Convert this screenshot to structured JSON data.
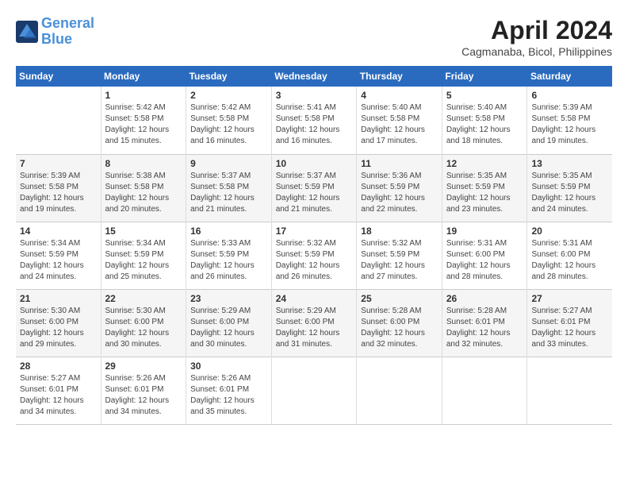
{
  "header": {
    "logo_line1": "General",
    "logo_line2": "Blue",
    "month": "April 2024",
    "location": "Cagmanaba, Bicol, Philippines"
  },
  "days_of_week": [
    "Sunday",
    "Monday",
    "Tuesday",
    "Wednesday",
    "Thursday",
    "Friday",
    "Saturday"
  ],
  "weeks": [
    [
      {
        "day": "",
        "info": ""
      },
      {
        "day": "1",
        "info": "Sunrise: 5:42 AM\nSunset: 5:58 PM\nDaylight: 12 hours\nand 15 minutes."
      },
      {
        "day": "2",
        "info": "Sunrise: 5:42 AM\nSunset: 5:58 PM\nDaylight: 12 hours\nand 16 minutes."
      },
      {
        "day": "3",
        "info": "Sunrise: 5:41 AM\nSunset: 5:58 PM\nDaylight: 12 hours\nand 16 minutes."
      },
      {
        "day": "4",
        "info": "Sunrise: 5:40 AM\nSunset: 5:58 PM\nDaylight: 12 hours\nand 17 minutes."
      },
      {
        "day": "5",
        "info": "Sunrise: 5:40 AM\nSunset: 5:58 PM\nDaylight: 12 hours\nand 18 minutes."
      },
      {
        "day": "6",
        "info": "Sunrise: 5:39 AM\nSunset: 5:58 PM\nDaylight: 12 hours\nand 19 minutes."
      }
    ],
    [
      {
        "day": "7",
        "info": "Sunrise: 5:39 AM\nSunset: 5:58 PM\nDaylight: 12 hours\nand 19 minutes."
      },
      {
        "day": "8",
        "info": "Sunrise: 5:38 AM\nSunset: 5:58 PM\nDaylight: 12 hours\nand 20 minutes."
      },
      {
        "day": "9",
        "info": "Sunrise: 5:37 AM\nSunset: 5:58 PM\nDaylight: 12 hours\nand 21 minutes."
      },
      {
        "day": "10",
        "info": "Sunrise: 5:37 AM\nSunset: 5:59 PM\nDaylight: 12 hours\nand 21 minutes."
      },
      {
        "day": "11",
        "info": "Sunrise: 5:36 AM\nSunset: 5:59 PM\nDaylight: 12 hours\nand 22 minutes."
      },
      {
        "day": "12",
        "info": "Sunrise: 5:35 AM\nSunset: 5:59 PM\nDaylight: 12 hours\nand 23 minutes."
      },
      {
        "day": "13",
        "info": "Sunrise: 5:35 AM\nSunset: 5:59 PM\nDaylight: 12 hours\nand 24 minutes."
      }
    ],
    [
      {
        "day": "14",
        "info": "Sunrise: 5:34 AM\nSunset: 5:59 PM\nDaylight: 12 hours\nand 24 minutes."
      },
      {
        "day": "15",
        "info": "Sunrise: 5:34 AM\nSunset: 5:59 PM\nDaylight: 12 hours\nand 25 minutes."
      },
      {
        "day": "16",
        "info": "Sunrise: 5:33 AM\nSunset: 5:59 PM\nDaylight: 12 hours\nand 26 minutes."
      },
      {
        "day": "17",
        "info": "Sunrise: 5:32 AM\nSunset: 5:59 PM\nDaylight: 12 hours\nand 26 minutes."
      },
      {
        "day": "18",
        "info": "Sunrise: 5:32 AM\nSunset: 5:59 PM\nDaylight: 12 hours\nand 27 minutes."
      },
      {
        "day": "19",
        "info": "Sunrise: 5:31 AM\nSunset: 6:00 PM\nDaylight: 12 hours\nand 28 minutes."
      },
      {
        "day": "20",
        "info": "Sunrise: 5:31 AM\nSunset: 6:00 PM\nDaylight: 12 hours\nand 28 minutes."
      }
    ],
    [
      {
        "day": "21",
        "info": "Sunrise: 5:30 AM\nSunset: 6:00 PM\nDaylight: 12 hours\nand 29 minutes."
      },
      {
        "day": "22",
        "info": "Sunrise: 5:30 AM\nSunset: 6:00 PM\nDaylight: 12 hours\nand 30 minutes."
      },
      {
        "day": "23",
        "info": "Sunrise: 5:29 AM\nSunset: 6:00 PM\nDaylight: 12 hours\nand 30 minutes."
      },
      {
        "day": "24",
        "info": "Sunrise: 5:29 AM\nSunset: 6:00 PM\nDaylight: 12 hours\nand 31 minutes."
      },
      {
        "day": "25",
        "info": "Sunrise: 5:28 AM\nSunset: 6:00 PM\nDaylight: 12 hours\nand 32 minutes."
      },
      {
        "day": "26",
        "info": "Sunrise: 5:28 AM\nSunset: 6:01 PM\nDaylight: 12 hours\nand 32 minutes."
      },
      {
        "day": "27",
        "info": "Sunrise: 5:27 AM\nSunset: 6:01 PM\nDaylight: 12 hours\nand 33 minutes."
      }
    ],
    [
      {
        "day": "28",
        "info": "Sunrise: 5:27 AM\nSunset: 6:01 PM\nDaylight: 12 hours\nand 34 minutes."
      },
      {
        "day": "29",
        "info": "Sunrise: 5:26 AM\nSunset: 6:01 PM\nDaylight: 12 hours\nand 34 minutes."
      },
      {
        "day": "30",
        "info": "Sunrise: 5:26 AM\nSunset: 6:01 PM\nDaylight: 12 hours\nand 35 minutes."
      },
      {
        "day": "",
        "info": ""
      },
      {
        "day": "",
        "info": ""
      },
      {
        "day": "",
        "info": ""
      },
      {
        "day": "",
        "info": ""
      }
    ]
  ]
}
